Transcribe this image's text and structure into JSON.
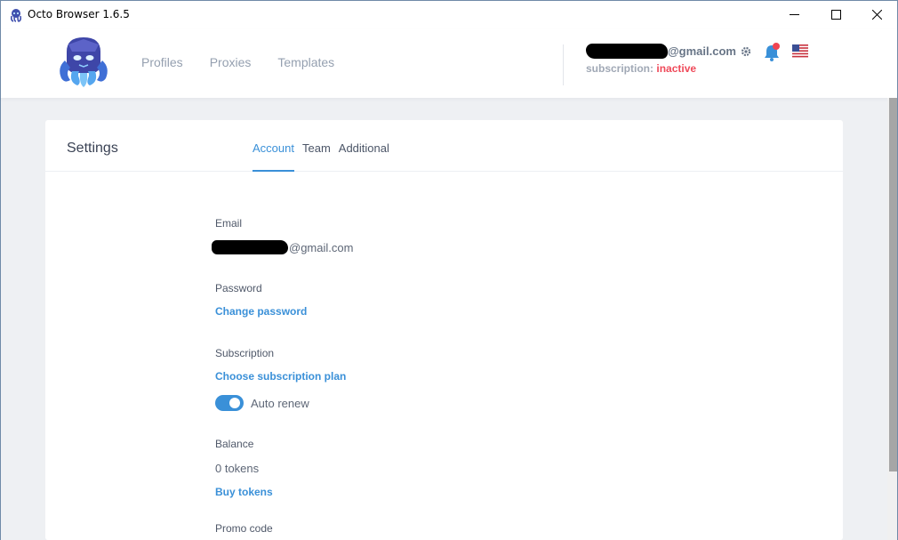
{
  "window": {
    "title": "Octo Browser 1.6.5"
  },
  "nav": {
    "items": [
      "Profiles",
      "Proxies",
      "Templates"
    ]
  },
  "account": {
    "email_visible": "@gmail.com",
    "subscription_label": "subscription:",
    "subscription_status": "inactive"
  },
  "settings": {
    "title": "Settings",
    "tabs": [
      {
        "label": "Account",
        "active": true
      },
      {
        "label": "Team",
        "active": false
      },
      {
        "label": "Additional",
        "active": false
      }
    ],
    "email_label": "Email",
    "email_visible": "@gmail.com",
    "password_label": "Password",
    "change_password": "Change password",
    "subscription_label": "Subscription",
    "choose_plan": "Choose subscription plan",
    "auto_renew_label": "Auto renew",
    "auto_renew_on": true,
    "balance_label": "Balance",
    "balance_value": "0 tokens",
    "buy_tokens": "Buy tokens",
    "promo_label": "Promo code"
  },
  "colors": {
    "accent": "#3a90d8",
    "inactive": "#ef4a5a",
    "notification_dot": "#f04451"
  }
}
